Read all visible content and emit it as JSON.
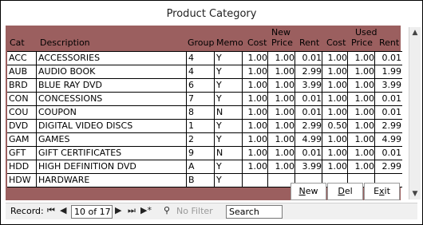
{
  "title": "Product Category",
  "header": {
    "cat": "Cat",
    "description": "Description",
    "group": "Group",
    "memo": "Memo",
    "new_group": "New",
    "used_group": "Used",
    "cost": "Cost",
    "price": "Price",
    "rent": "Rent"
  },
  "rows": [
    {
      "cat": "ACC",
      "description": "ACCESSORIES",
      "group": "4",
      "memo": "Y",
      "new_cost": "1.00",
      "new_price": "1.00",
      "new_rent": "0.01",
      "used_cost": "1.00",
      "used_price": "1.00",
      "used_rent": "0.01"
    },
    {
      "cat": "AUB",
      "description": "AUDIO BOOK",
      "group": "4",
      "memo": "Y",
      "new_cost": "1.00",
      "new_price": "1.00",
      "new_rent": "2.99",
      "used_cost": "1.00",
      "used_price": "1.00",
      "used_rent": "1.99"
    },
    {
      "cat": "BRD",
      "description": "BLUE RAY DVD",
      "group": "6",
      "memo": "Y",
      "new_cost": "1.00",
      "new_price": "1.00",
      "new_rent": "3.99",
      "used_cost": "1.00",
      "used_price": "1.00",
      "used_rent": "3.99"
    },
    {
      "cat": "CON",
      "description": "CONCESSIONS",
      "group": "7",
      "memo": "Y",
      "new_cost": "1.00",
      "new_price": "1.00",
      "new_rent": "0.01",
      "used_cost": "1.00",
      "used_price": "1.00",
      "used_rent": "0.01"
    },
    {
      "cat": "COU",
      "description": "COUPON",
      "group": "8",
      "memo": "N",
      "new_cost": "1.00",
      "new_price": "1.00",
      "new_rent": "0.01",
      "used_cost": "1.00",
      "used_price": "1.00",
      "used_rent": "0.01"
    },
    {
      "cat": "DVD",
      "description": "DIGITAL VIDEO DISCS",
      "group": "1",
      "memo": "Y",
      "new_cost": "1.00",
      "new_price": "1.00",
      "new_rent": "2.99",
      "used_cost": "0.50",
      "used_price": "1.00",
      "used_rent": "2.99"
    },
    {
      "cat": "GAM",
      "description": "GAMES",
      "group": "2",
      "memo": "Y",
      "new_cost": "1.00",
      "new_price": "1.00",
      "new_rent": "4.99",
      "used_cost": "1.00",
      "used_price": "1.00",
      "used_rent": "4.99"
    },
    {
      "cat": "GFT",
      "description": "GIFT CERTIFICATES",
      "group": "9",
      "memo": "N",
      "new_cost": "1.00",
      "new_price": "1.00",
      "new_rent": "0.01",
      "used_cost": "1.00",
      "used_price": "1.00",
      "used_rent": "0.01"
    },
    {
      "cat": "HDD",
      "description": "HIGH DEFINITION DVD",
      "group": "A",
      "memo": "Y",
      "new_cost": "1.00",
      "new_price": "1.00",
      "new_rent": "3.99",
      "used_cost": "1.00",
      "used_price": "1.00",
      "used_rent": "2.99"
    },
    {
      "cat": "HDW",
      "description": "HARDWARE",
      "group": "B",
      "memo": "Y",
      "new_cost": "",
      "new_price": "",
      "new_rent": "",
      "used_cost": "",
      "used_price": "",
      "used_rent": ""
    }
  ],
  "buttons": {
    "new": {
      "prefix": "",
      "accel": "N",
      "suffix": "ew"
    },
    "del": {
      "prefix": "",
      "accel": "D",
      "suffix": "el"
    },
    "exit": {
      "prefix": "E",
      "accel": "x",
      "suffix": "it"
    }
  },
  "nav": {
    "record_label": "Record:",
    "record_value": "10 of 17",
    "filter_label": "No Filter",
    "search_placeholder": "Search",
    "first_icon": "⏮",
    "prev_icon": "◀",
    "next_icon": "▶",
    "last_icon": "⏭",
    "new_icon": "▶*",
    "filter_icon": "⚲"
  }
}
